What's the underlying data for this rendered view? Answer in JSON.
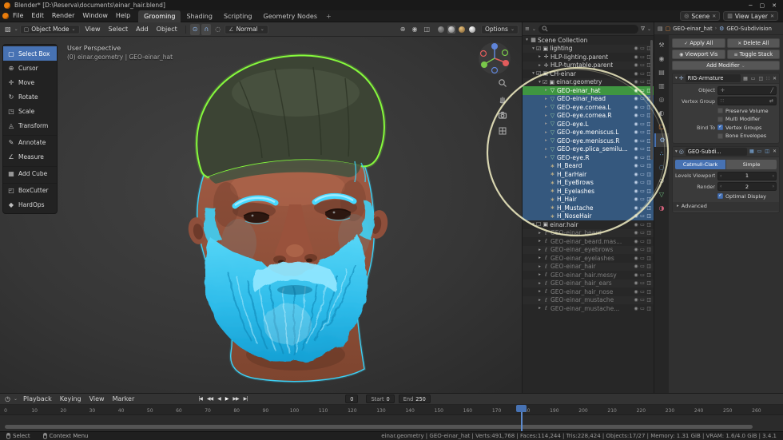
{
  "window": {
    "title": "Blender*  [D:\\Reserva\\documents\\einar_hair.blend]"
  },
  "menubar": {
    "menus": [
      "File",
      "Edit",
      "Render",
      "Window",
      "Help"
    ],
    "workspaces": [
      "Grooming",
      "Shading",
      "Scripting",
      "Geometry Nodes"
    ],
    "active_workspace": "Grooming",
    "add_workspace": "+",
    "scene": "Scene",
    "view_layer": "View Layer"
  },
  "tool_header": {
    "mode": "Object Mode",
    "menus": [
      "View",
      "Select",
      "Add",
      "Object"
    ],
    "orientation": "Normal",
    "options_label": "Options"
  },
  "toolbar": {
    "tools": [
      {
        "label": "Select Box",
        "icon": "box-select",
        "active": true
      },
      {
        "label": "Cursor",
        "icon": "cursor"
      },
      {
        "label": "Move",
        "icon": "move"
      },
      {
        "label": "Rotate",
        "icon": "rotate"
      },
      {
        "label": "Scale",
        "icon": "scale"
      },
      {
        "label": "Transform",
        "icon": "transform"
      },
      {
        "label": "Annotate",
        "icon": "annotate",
        "gap": true
      },
      {
        "label": "Measure",
        "icon": "measure"
      },
      {
        "label": "Add Cube",
        "icon": "add-cube",
        "gap": true
      },
      {
        "label": "BoxCutter",
        "icon": "boxcutter",
        "gap": true
      },
      {
        "label": "HardOps",
        "icon": "hardops"
      }
    ]
  },
  "viewport": {
    "view_label": "User Perspective",
    "context_label": "(0) einar.geometry | GEO-einar_hat"
  },
  "outliner": {
    "rows": [
      {
        "name": "Scene Collection",
        "depth": 0,
        "icon": "scene-collection",
        "arrow": "▾",
        "state": "normal",
        "bare": true
      },
      {
        "name": "lighting",
        "depth": 1,
        "icon": "collection",
        "arrow": "▾",
        "check": true,
        "state": "normal"
      },
      {
        "name": "HLP-lighting.parent",
        "depth": 2,
        "icon": "empty",
        "arrow": "▸",
        "state": "normal"
      },
      {
        "name": "HLP-turntable.parent",
        "depth": 2,
        "icon": "empty",
        "arrow": "▸",
        "state": "normal"
      },
      {
        "name": "CH-einar",
        "depth": 1,
        "icon": "collection",
        "arrow": "▾",
        "check": true,
        "state": "normal"
      },
      {
        "name": "einar.geometry",
        "depth": 2,
        "icon": "collection",
        "arrow": "▾",
        "check": true,
        "state": "normal"
      },
      {
        "name": "GEO-einar_hat",
        "depth": 3,
        "icon": "mesh",
        "arrow": "▸",
        "state": "active"
      },
      {
        "name": "GEO-einar_head",
        "depth": 3,
        "icon": "mesh",
        "arrow": "▸",
        "state": "selected"
      },
      {
        "name": "GEO-eye.cornea.L",
        "depth": 3,
        "icon": "mesh",
        "arrow": "▸",
        "state": "selected"
      },
      {
        "name": "GEO-eye.cornea.R",
        "depth": 3,
        "icon": "mesh",
        "arrow": "▸",
        "state": "selected"
      },
      {
        "name": "GEO-eye.L",
        "depth": 3,
        "icon": "mesh",
        "arrow": "▸",
        "state": "selected"
      },
      {
        "name": "GEO-eye.meniscus.L",
        "depth": 3,
        "icon": "mesh",
        "arrow": "▸",
        "state": "selected"
      },
      {
        "name": "GEO-eye.meniscus.R",
        "depth": 3,
        "icon": "mesh",
        "arrow": "▸",
        "state": "selected"
      },
      {
        "name": "GEO-eye.plica_semilu...",
        "depth": 3,
        "icon": "mesh",
        "arrow": "▸",
        "state": "selected"
      },
      {
        "name": "GEO-eye.R",
        "depth": 3,
        "icon": "mesh",
        "arrow": "▸",
        "state": "selected"
      },
      {
        "name": "H_Beard",
        "depth": 3,
        "icon": "particles",
        "arrow": "",
        "state": "selected"
      },
      {
        "name": "H_EarHair",
        "depth": 3,
        "icon": "particles",
        "arrow": "",
        "state": "selected"
      },
      {
        "name": "H_EyeBrows",
        "depth": 3,
        "icon": "particles",
        "arrow": "",
        "state": "selected"
      },
      {
        "name": "H_Eyelashes",
        "depth": 3,
        "icon": "particles",
        "arrow": "",
        "state": "selected"
      },
      {
        "name": "H_Hair",
        "depth": 3,
        "icon": "particles",
        "arrow": "",
        "state": "selected"
      },
      {
        "name": "H_Mustache",
        "depth": 3,
        "icon": "particles",
        "arrow": "",
        "state": "selected"
      },
      {
        "name": "H_NoseHair",
        "depth": 3,
        "icon": "particles",
        "arrow": "",
        "state": "selected"
      },
      {
        "name": "einar.hair",
        "depth": 1,
        "icon": "collection",
        "arrow": "▾",
        "check": false,
        "state": "normal"
      },
      {
        "name": "GEO-einar_beard",
        "depth": 2,
        "icon": "curves",
        "arrow": "▸",
        "state": "excluded"
      },
      {
        "name": "GEO-einar_beard.mas...",
        "depth": 2,
        "icon": "curves",
        "arrow": "▸",
        "state": "excluded"
      },
      {
        "name": "GEO-einar_eyebrows",
        "depth": 2,
        "icon": "curves",
        "arrow": "▸",
        "state": "excluded"
      },
      {
        "name": "GEO-einar_eyelashes",
        "depth": 2,
        "icon": "curves",
        "arrow": "▸",
        "state": "excluded"
      },
      {
        "name": "GEO-einar_hair",
        "depth": 2,
        "icon": "curves",
        "arrow": "▸",
        "state": "excluded"
      },
      {
        "name": "GEO-einar_hair.messy",
        "depth": 2,
        "icon": "curves",
        "arrow": "▸",
        "state": "excluded"
      },
      {
        "name": "GEO-einar_hair_ears",
        "depth": 2,
        "icon": "curves",
        "arrow": "▸",
        "state": "excluded"
      },
      {
        "name": "GEO-einar_hair_nose",
        "depth": 2,
        "icon": "curves",
        "arrow": "▸",
        "state": "excluded"
      },
      {
        "name": "GEO-einar_mustache",
        "depth": 2,
        "icon": "curves",
        "arrow": "▸",
        "state": "excluded"
      },
      {
        "name": "GEO-einar_mustache...",
        "depth": 2,
        "icon": "curves",
        "arrow": "▸",
        "state": "excluded"
      }
    ]
  },
  "properties": {
    "breadcrumb": {
      "object": "GEO-einar_hat",
      "modifier": "GEO-Subdivision"
    },
    "tabs": [
      {
        "name": "tool"
      },
      {
        "name": "render"
      },
      {
        "name": "output"
      },
      {
        "name": "view-layer"
      },
      {
        "name": "scene"
      },
      {
        "name": "world"
      },
      {
        "name": "object"
      },
      {
        "name": "modifiers",
        "active": true
      },
      {
        "name": "particles"
      },
      {
        "name": "physics"
      },
      {
        "name": "constraints"
      },
      {
        "name": "object-data"
      },
      {
        "name": "material"
      }
    ],
    "actions": {
      "apply_all": "Apply All",
      "delete_all": "Delete All",
      "viewport_vis": "Viewport Vis",
      "toggle_stack": "Toggle Stack",
      "add_modifier": "Add Modifier"
    },
    "modifiers": [
      {
        "name": "RIG-Armature",
        "object_label": "Object",
        "vertex_group_label": "Vertex Group",
        "preserve_volume": "Preserve Volume",
        "multi_modifier": "Multi Modifier",
        "bind_to_label": "Bind To",
        "vertex_groups": "Vertex Groups",
        "bone_envelopes": "Bone Envelopes"
      },
      {
        "name": "GEO-Subdi...",
        "types": [
          "Catmull-Clark",
          "Simple"
        ],
        "active_type": "Catmull-Clark",
        "levels_label": "Levels Viewport",
        "levels_value": "1",
        "render_label": "Render",
        "render_value": "2",
        "optimal_display": "Optimal Display",
        "advanced_label": "Advanced"
      }
    ]
  },
  "timeline": {
    "menus": [
      "Playback",
      "Keying",
      "View",
      "Marker"
    ],
    "transport": [
      "jump-to-start",
      "prev-keyframe",
      "play-reverse",
      "play",
      "next-keyframe",
      "jump-to-end"
    ],
    "frame_value": "0",
    "start_label": "Start",
    "start_value": "0",
    "end_label": "End",
    "end_value": "250",
    "ruler": [
      "0",
      "10",
      "20",
      "30",
      "40",
      "50",
      "60",
      "70",
      "80",
      "90",
      "100",
      "110",
      "120",
      "130",
      "140",
      "150",
      "160",
      "170",
      "180",
      "190",
      "200",
      "210",
      "220",
      "230",
      "240",
      "250",
      "260"
    ]
  },
  "statusbar": {
    "hints": [
      {
        "label": "Select"
      },
      {
        "label": "Context Menu"
      }
    ],
    "stats": "einar.geometry | GEO-einar_hat | Verts:491,768 | Faces:114,244 | Tris:228,424 | Objects:17/27 | Memory: 1.31 GiB | VRAM: 1.6/4.0 GiB | 3.4.1"
  },
  "colors": {
    "accent": "#4772b3",
    "selected_row": "#35587e",
    "active_row": "#3f9641",
    "hair_particles": "#3cd0f5",
    "selection_outline": "#86fa3c",
    "annotation": "#f0ecc2"
  }
}
